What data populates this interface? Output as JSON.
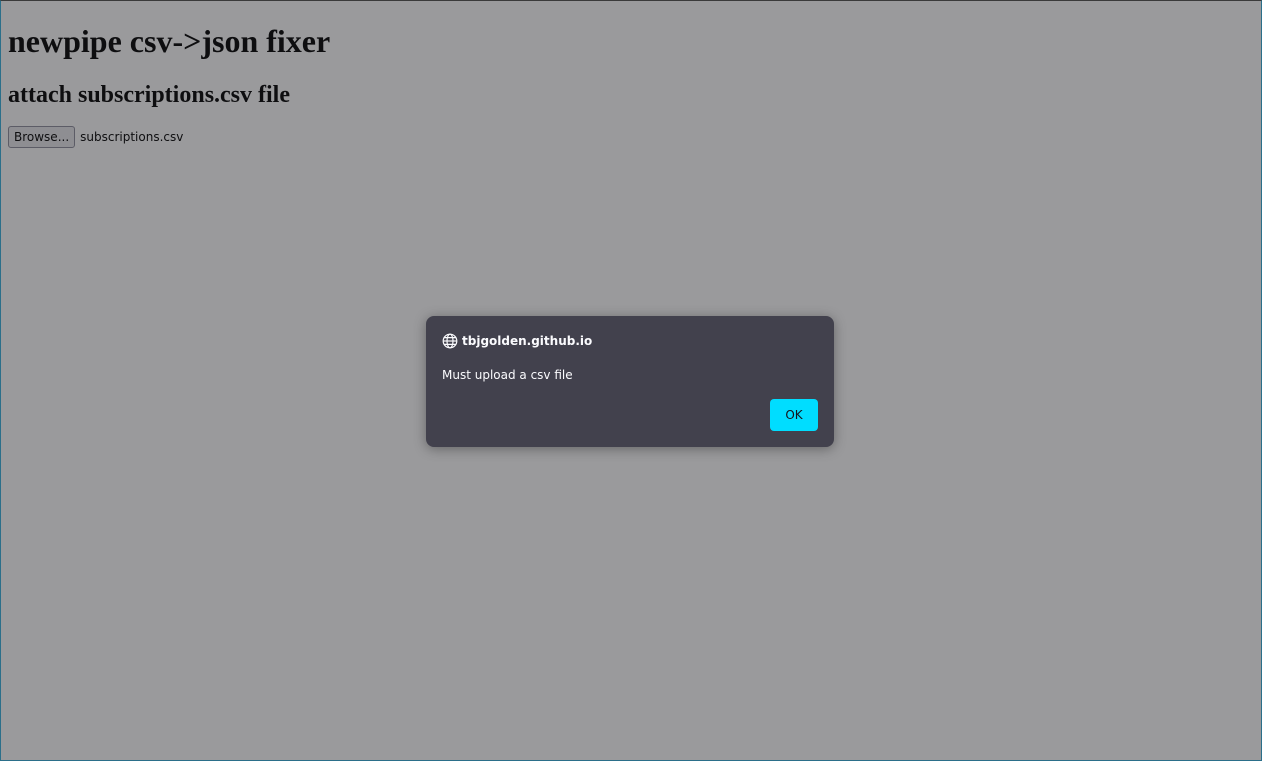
{
  "page": {
    "title": "newpipe csv->json fixer",
    "subtitle": "attach subscriptions.csv file",
    "file_input": {
      "button_label": "Browse...",
      "selected_file": "subscriptions.csv"
    }
  },
  "dialog": {
    "origin": "tbjgolden.github.io",
    "origin_icon": "globe-icon",
    "message": "Must upload a csv file",
    "ok_label": "OK"
  },
  "colors": {
    "dialog_background": "#42414d",
    "ok_button": "#00ddff",
    "overlay": "rgba(30,30,35,0.45)"
  }
}
